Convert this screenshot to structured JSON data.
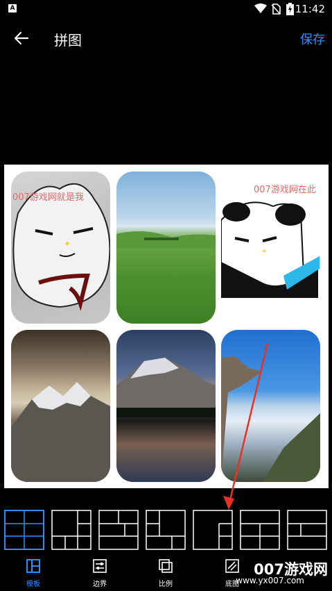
{
  "status": {
    "time": "11:42",
    "app_icon_letter": "A",
    "icons": [
      "wifi-icon",
      "no-sim-icon",
      "battery-charging-icon"
    ]
  },
  "header": {
    "title": "拼图",
    "save_label": "保存",
    "back_icon": "arrow-left-icon"
  },
  "canvas": {
    "watermark_left": "007游戏网就是我",
    "watermark_right": "007游戏网在此"
  },
  "templates": {
    "selected_index": 0,
    "count": 7
  },
  "nav": {
    "items": [
      {
        "label": "模板",
        "icon": "template-icon"
      },
      {
        "label": "边界",
        "icon": "border-icon"
      },
      {
        "label": "比例",
        "icon": "ratio-icon"
      },
      {
        "label": "底图",
        "icon": "background-icon"
      }
    ]
  },
  "brand": {
    "name": "007游戏网",
    "url": "www.yx007.com"
  },
  "colors": {
    "accent": "#2f8dff",
    "selected_template": "#2f8dff",
    "watermark": "#e06a6a",
    "arrow": "#e53225"
  }
}
